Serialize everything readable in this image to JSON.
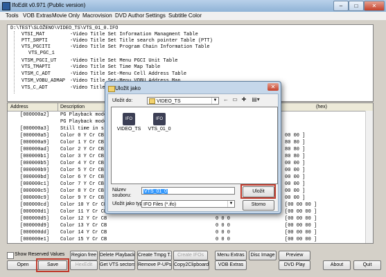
{
  "window": {
    "title": "IfoEdit v0.971 (Public version)",
    "min": "–",
    "max": "□",
    "close": "✕"
  },
  "menu": [
    "Tools",
    "VOB Extras",
    "Movie Only",
    "Macrovision",
    "DVD Author",
    "Settings",
    "Subtitle Color"
  ],
  "tree": {
    "root": "D:\\TEST\\SLOŽENO\\VIDEO_TS\\VTS_01_0.IFO",
    "rows": [
      {
        "name": "VTSI_MAT",
        "desc": "-Video Title Set Information Managment Table"
      },
      {
        "name": "PTT_SRPTI",
        "desc": "-Video Title Set Title search pointer Table (PTT)"
      },
      {
        "name": "VTS_PGCITI",
        "desc": "-Video Title Set Program Chain Information Table"
      },
      {
        "name": "VTS_PGC_1",
        "desc": ""
      },
      {
        "name": "VTSM_PGCI_UT",
        "desc": "-Video Title Set Menu PGCI Unit Table"
      },
      {
        "name": "VTS_TMAPTI",
        "desc": "-Video Title Set Time Map Table"
      },
      {
        "name": "VTSM_C_ADT",
        "desc": "-Video Title Set-Menu Cell Address Table"
      },
      {
        "name": "VTSM_VOBU_ADMAP",
        "desc": "-Video Title Set-Menu VOBU Address Map"
      },
      {
        "name": "VTS_C_ADT",
        "desc": "-Video Title Set Cell Address Table"
      }
    ]
  },
  "grid": {
    "headers": [
      "Address",
      "Description",
      "(hex)"
    ],
    "rows": [
      {
        "addr": "[000000a2]",
        "desc": "PG Playback mode",
        "val": "",
        "hex": ""
      },
      {
        "addr": "",
        "desc": "PG Playback mode",
        "val": "",
        "hex": ""
      },
      {
        "addr": "[000000a3]",
        "desc": "Still time in s",
        "val": "",
        "hex": ""
      },
      {
        "addr": "[000000a5]",
        "desc": "Color 0 Y Cr CB",
        "val": "",
        "hex": "00 00 ]"
      },
      {
        "addr": "[000000a9]",
        "desc": "Color 1 Y Cr CB",
        "val": "",
        "hex": "80 80 ]"
      },
      {
        "addr": "[000000ad]",
        "desc": "Color 2 Y Cr CB",
        "val": "",
        "hex": "80 80 ]"
      },
      {
        "addr": "[000000b1]",
        "desc": "Color 3 Y Cr CB",
        "val": "",
        "hex": "80 80 ]"
      },
      {
        "addr": "[000000b5]",
        "desc": "Color 4 Y Cr CB",
        "val": "",
        "hex": "00 00 ]"
      },
      {
        "addr": "[000000b9]",
        "desc": "Color 5 Y Cr CB",
        "val": "",
        "hex": "00 00 ]"
      },
      {
        "addr": "[000000bd]",
        "desc": "Color 6 Y Cr CB",
        "val": "",
        "hex": "00 00 ]"
      },
      {
        "addr": "[000000c1]",
        "desc": "Color 7 Y Cr CB",
        "val": "",
        "hex": "00 00 ]"
      },
      {
        "addr": "[000000c5]",
        "desc": "Color 8 Y Cr CB",
        "val": "",
        "hex": "00 00 ]"
      },
      {
        "addr": "[000000c9]",
        "desc": "Color 9 Y Cr CB",
        "val": "",
        "hex": "00 00 ]"
      },
      {
        "addr": "[000000cd]",
        "desc": "Color 10 Y Cr CB",
        "val": "0 0 0",
        "hex": "[00 00 00 ]"
      },
      {
        "addr": "[000000d1]",
        "desc": "Color 11 Y Cr CB",
        "val": "0 0 0",
        "hex": "[00 00 00 ]"
      },
      {
        "addr": "[000000d5]",
        "desc": "Color 12 Y Cr CB",
        "val": "0 0 0",
        "hex": "[00 00 00 ]"
      },
      {
        "addr": "[000000d9]",
        "desc": "Color 13 Y Cr CB",
        "val": "0 0 0",
        "hex": "[00 00 00 ]"
      },
      {
        "addr": "[000000dd]",
        "desc": "Color 14 Y Cr CB",
        "val": "0 0 0",
        "hex": "[00 00 00 ]"
      },
      {
        "addr": "[000000e1]",
        "desc": "Color 15 Y Cr CB",
        "val": "0 0 0",
        "hex": "[00 00 00 ]"
      }
    ]
  },
  "buttons": {
    "show_reserved": "Show Reserved Values",
    "region_free": "Region free",
    "delete_playback": "Delete Playback",
    "create_tmpg": "Create Tmpg T.",
    "create_ifos": "Create IFOs",
    "menu_extras": "Menu Extras",
    "disc_image": "Disc Image",
    "preview": "Preview",
    "open": "Open",
    "save": "Save",
    "hexedit": "HexEdit",
    "get_vts": "Get VTS sectors",
    "remove_pups": "Remove P-UPs",
    "copy2clip": "Copy2Clipboard",
    "vob_extras": "VOB Extras",
    "dvd_play": "DVD Play",
    "about": "About",
    "quit": "Quit"
  },
  "dialog": {
    "title": "Uložit jako",
    "close": "✕",
    "save_in_label": "Uložit do:",
    "save_in_value": "VIDEO_TS",
    "files": [
      {
        "name": "VIDEO_TS",
        "icon": "IFO"
      },
      {
        "name": "VTS_01_0",
        "icon": "IFO"
      }
    ],
    "filename_label": "Název souboru:",
    "filename_value": "VTS_01_0",
    "type_label": "Uložit jako typ:",
    "type_value": "IFO Files (*.ifo)",
    "save_button": "Uložit",
    "cancel_button": "Storno"
  },
  "colors": {
    "highlight": "#c0392b",
    "selection": "#3399ff"
  }
}
